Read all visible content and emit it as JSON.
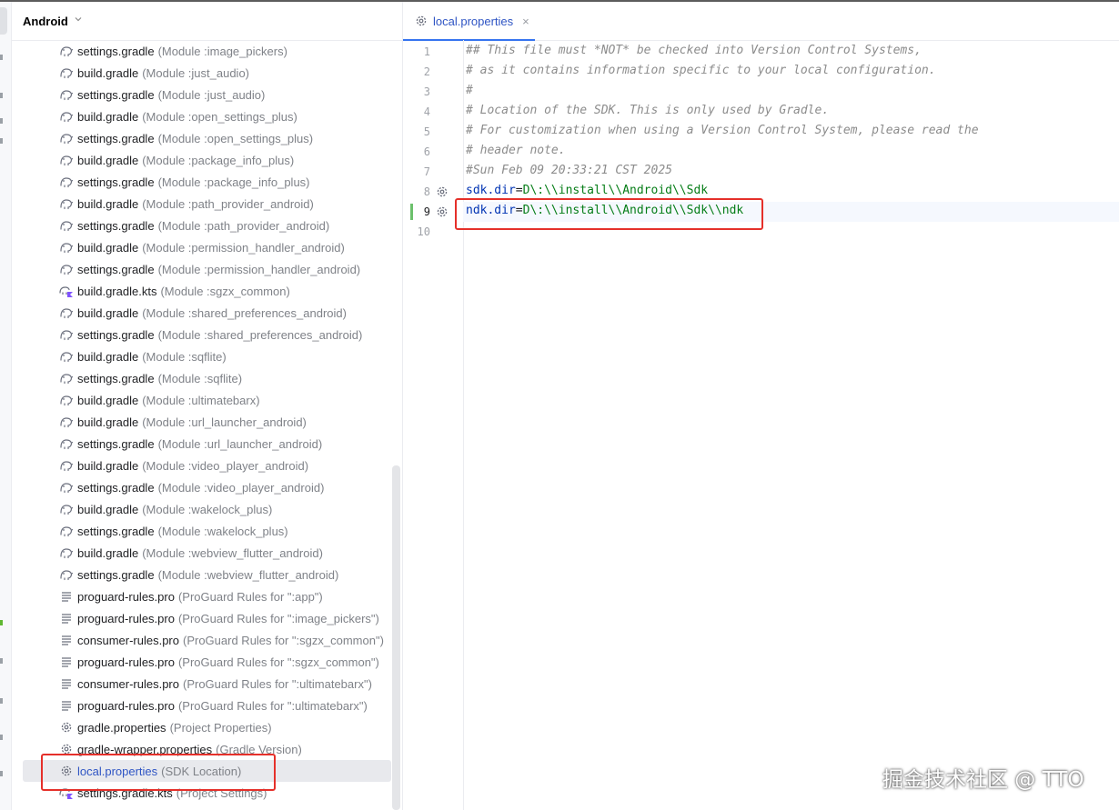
{
  "panel": {
    "title": "Android",
    "items": [
      {
        "name": "settings.gradle",
        "hint": "(Module :image_pickers)",
        "icon": "gradle-elephant-icon"
      },
      {
        "name": "build.gradle",
        "hint": "(Module :just_audio)",
        "icon": "gradle-elephant-icon"
      },
      {
        "name": "settings.gradle",
        "hint": "(Module :just_audio)",
        "icon": "gradle-elephant-icon"
      },
      {
        "name": "build.gradle",
        "hint": "(Module :open_settings_plus)",
        "icon": "gradle-elephant-icon"
      },
      {
        "name": "settings.gradle",
        "hint": "(Module :open_settings_plus)",
        "icon": "gradle-elephant-icon"
      },
      {
        "name": "build.gradle",
        "hint": "(Module :package_info_plus)",
        "icon": "gradle-elephant-icon"
      },
      {
        "name": "settings.gradle",
        "hint": "(Module :package_info_plus)",
        "icon": "gradle-elephant-icon"
      },
      {
        "name": "build.gradle",
        "hint": "(Module :path_provider_android)",
        "icon": "gradle-elephant-icon"
      },
      {
        "name": "settings.gradle",
        "hint": "(Module :path_provider_android)",
        "icon": "gradle-elephant-icon"
      },
      {
        "name": "build.gradle",
        "hint": "(Module :permission_handler_android)",
        "icon": "gradle-elephant-icon"
      },
      {
        "name": "settings.gradle",
        "hint": "(Module :permission_handler_android)",
        "icon": "gradle-elephant-icon"
      },
      {
        "name": "build.gradle.kts",
        "hint": "(Module :sgzx_common)",
        "icon": "gradle-kts-icon"
      },
      {
        "name": "build.gradle",
        "hint": "(Module :shared_preferences_android)",
        "icon": "gradle-elephant-icon"
      },
      {
        "name": "settings.gradle",
        "hint": "(Module :shared_preferences_android)",
        "icon": "gradle-elephant-icon"
      },
      {
        "name": "build.gradle",
        "hint": "(Module :sqflite)",
        "icon": "gradle-elephant-icon"
      },
      {
        "name": "settings.gradle",
        "hint": "(Module :sqflite)",
        "icon": "gradle-elephant-icon"
      },
      {
        "name": "build.gradle",
        "hint": "(Module :ultimatebarx)",
        "icon": "gradle-elephant-icon"
      },
      {
        "name": "build.gradle",
        "hint": "(Module :url_launcher_android)",
        "icon": "gradle-elephant-icon"
      },
      {
        "name": "settings.gradle",
        "hint": "(Module :url_launcher_android)",
        "icon": "gradle-elephant-icon"
      },
      {
        "name": "build.gradle",
        "hint": "(Module :video_player_android)",
        "icon": "gradle-elephant-icon"
      },
      {
        "name": "settings.gradle",
        "hint": "(Module :video_player_android)",
        "icon": "gradle-elephant-icon"
      },
      {
        "name": "build.gradle",
        "hint": "(Module :wakelock_plus)",
        "icon": "gradle-elephant-icon"
      },
      {
        "name": "settings.gradle",
        "hint": "(Module :wakelock_plus)",
        "icon": "gradle-elephant-icon"
      },
      {
        "name": "build.gradle",
        "hint": "(Module :webview_flutter_android)",
        "icon": "gradle-elephant-icon"
      },
      {
        "name": "settings.gradle",
        "hint": "(Module :webview_flutter_android)",
        "icon": "gradle-elephant-icon"
      },
      {
        "name": "proguard-rules.pro",
        "hint": "(ProGuard Rules for \":app\")",
        "icon": "text-file-icon"
      },
      {
        "name": "proguard-rules.pro",
        "hint": "(ProGuard Rules for \":image_pickers\")",
        "icon": "text-file-icon"
      },
      {
        "name": "consumer-rules.pro",
        "hint": "(ProGuard Rules for \":sgzx_common\")",
        "icon": "text-file-icon"
      },
      {
        "name": "proguard-rules.pro",
        "hint": "(ProGuard Rules for \":sgzx_common\")",
        "icon": "text-file-icon"
      },
      {
        "name": "consumer-rules.pro",
        "hint": "(ProGuard Rules for \":ultimatebarx\")",
        "icon": "text-file-icon"
      },
      {
        "name": "proguard-rules.pro",
        "hint": "(ProGuard Rules for \":ultimatebarx\")",
        "icon": "text-file-icon"
      },
      {
        "name": "gradle.properties",
        "hint": "(Project Properties)",
        "icon": "properties-gear-icon"
      },
      {
        "name": "gradle-wrapper.properties",
        "hint": "(Gradle Version)",
        "icon": "properties-gear-icon"
      },
      {
        "name": "local.properties",
        "hint": "(SDK Location)",
        "icon": "properties-gear-icon",
        "selected": true
      },
      {
        "name": "settings.gradle.kts",
        "hint": "(Project Settings)",
        "icon": "gradle-kts-icon"
      }
    ]
  },
  "editor": {
    "tab": {
      "label": "local.properties",
      "icon": "properties-gear-icon",
      "close": "×"
    },
    "lines": [
      {
        "n": "1",
        "parts": [
          {
            "t": "## This file must *NOT* be checked into Version Control Systems,",
            "c": "comment"
          }
        ]
      },
      {
        "n": "2",
        "parts": [
          {
            "t": "# as it contains information specific to your local configuration.",
            "c": "comment"
          }
        ]
      },
      {
        "n": "3",
        "parts": [
          {
            "t": "#",
            "c": "comment"
          }
        ]
      },
      {
        "n": "4",
        "parts": [
          {
            "t": "# Location of the SDK. This is only used by Gradle.",
            "c": "comment"
          }
        ]
      },
      {
        "n": "5",
        "parts": [
          {
            "t": "# For customization when using a Version Control System, please read the",
            "c": "comment"
          }
        ]
      },
      {
        "n": "6",
        "parts": [
          {
            "t": "# header note.",
            "c": "comment"
          }
        ]
      },
      {
        "n": "7",
        "parts": [
          {
            "t": "#Sun Feb 09 20:33:21 CST 2025",
            "c": "comment"
          }
        ]
      },
      {
        "n": "8",
        "gear": true,
        "parts": [
          {
            "t": "sdk.dir",
            "c": "key"
          },
          {
            "t": "=",
            "c": "eq"
          },
          {
            "t": "D\\:\\\\install\\\\Android\\\\Sdk",
            "c": "val"
          }
        ]
      },
      {
        "n": "9",
        "gear": true,
        "current": true,
        "changed": true,
        "parts": [
          {
            "t": "ndk.dir",
            "c": "key"
          },
          {
            "t": "=",
            "c": "eq"
          },
          {
            "t": "D\\:\\\\install\\\\Android\\\\Sdk\\\\ndk",
            "c": "val"
          }
        ]
      },
      {
        "n": "10",
        "parts": []
      }
    ]
  },
  "watermark": "掘金技术社区 @ TTO",
  "colors": {
    "highlight_box": "#e5302a",
    "accent": "#3574f0",
    "link": "#2f55c4"
  }
}
